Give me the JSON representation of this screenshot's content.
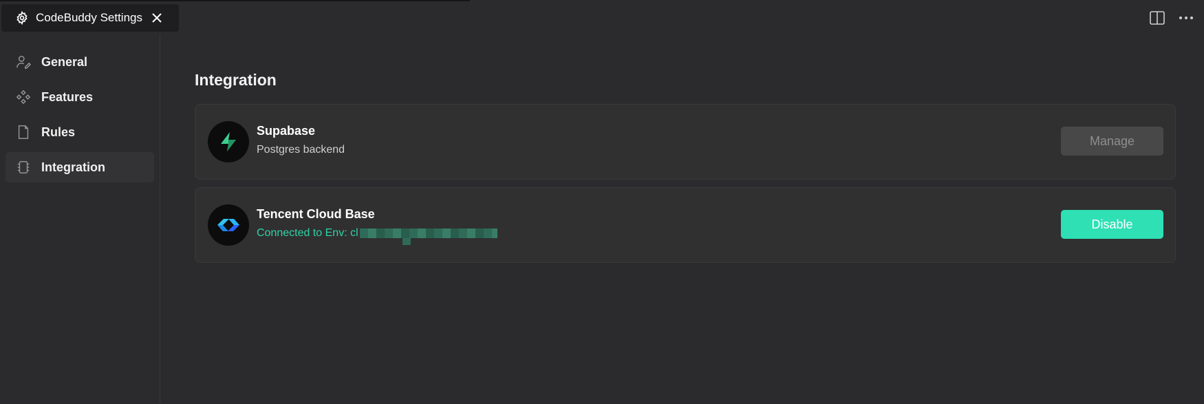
{
  "tab": {
    "title": "CodeBuddy Settings"
  },
  "sidebar": {
    "items": [
      {
        "label": "General",
        "icon": "user-edit-icon"
      },
      {
        "label": "Features",
        "icon": "features-diamonds-icon"
      },
      {
        "label": "Rules",
        "icon": "document-icon"
      },
      {
        "label": "Integration",
        "icon": "integration-chip-icon",
        "active": true
      }
    ]
  },
  "main": {
    "title": "Integration",
    "integrations": [
      {
        "name": "Supabase",
        "description": "Postgres backend",
        "button": "Manage",
        "icon": "supabase-bolt-icon"
      },
      {
        "name": "Tencent Cloud Base",
        "description": "Connected to Env: cl",
        "description_color": "#2fd3a5",
        "button": "Disable",
        "button_color": "#2fe0b5",
        "icon": "tencent-cloudbase-icon"
      }
    ]
  }
}
